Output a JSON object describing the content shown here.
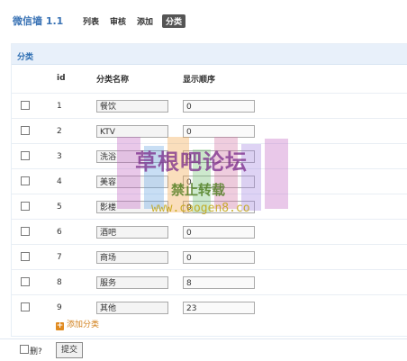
{
  "header": {
    "app_title": "微信墙 1.1",
    "nav": [
      {
        "label": "列表"
      },
      {
        "label": "审核"
      },
      {
        "label": "添加"
      },
      {
        "label": "分类",
        "active": true
      }
    ]
  },
  "panel": {
    "title": "分类",
    "columns": {
      "id": "id",
      "name": "分类名称",
      "order": "显示顺序"
    },
    "rows": [
      {
        "id": "1",
        "name": "餐饮",
        "order": "0"
      },
      {
        "id": "2",
        "name": "KTV",
        "order": "0"
      },
      {
        "id": "3",
        "name": "洗浴",
        "order": "0"
      },
      {
        "id": "4",
        "name": "美容",
        "order": "0"
      },
      {
        "id": "5",
        "name": "影楼",
        "order": "0"
      },
      {
        "id": "6",
        "name": "酒吧",
        "order": "0"
      },
      {
        "id": "7",
        "name": "商场",
        "order": "0"
      },
      {
        "id": "8",
        "name": "服务",
        "order": "8"
      },
      {
        "id": "9",
        "name": "其他",
        "order": "23"
      }
    ],
    "add_label": "添加分类"
  },
  "footer": {
    "delete_label": "删?",
    "submit_label": "提交"
  },
  "watermark": {
    "main": "草根吧论坛",
    "sub": "禁止转载",
    "url": "www.caogen8.co"
  },
  "colors": {
    "accent": "#3a73b5",
    "panel_head": "#e8f0fa",
    "add_link": "#d1801c"
  }
}
